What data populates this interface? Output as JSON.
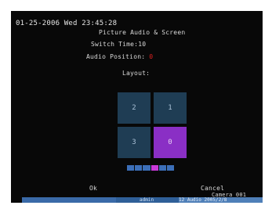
{
  "header": {
    "datetime": "01-25-2006 Wed 23:45:28",
    "title": "Picture Audio & Screen"
  },
  "settings": {
    "switch_time": "Switch Time:10",
    "audio_label": "Audio Position:",
    "audio_value": "0",
    "layout_label": "Layout:"
  },
  "layout_grid": {
    "cells": [
      "2",
      "1",
      "3",
      "0"
    ],
    "selected": "0"
  },
  "page_indicator": {
    "count": 6,
    "active_index": 3
  },
  "footer": {
    "ok_label": "Ok",
    "cancel_label": "Cancel",
    "save_label": "Camera 001",
    "status_mid": "admin",
    "status_right": "12 Audio 2005/2/8"
  },
  "colors": {
    "screen_bg": "#080808",
    "cell": "#1f3d54",
    "cell_selected": "#8a2fc5",
    "audio_value": "#e02020",
    "bar": "#2f5f98"
  }
}
